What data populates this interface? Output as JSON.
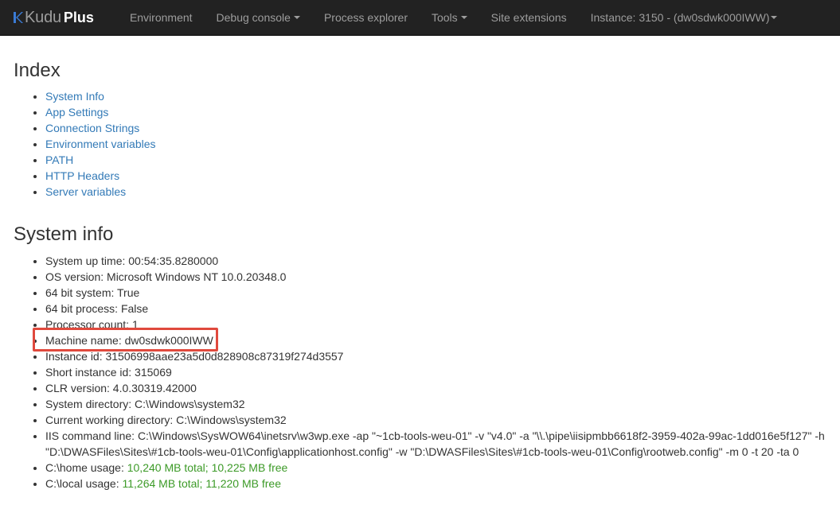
{
  "navbar": {
    "brand_kudu": "Kudu",
    "brand_plus": "Plus",
    "items": [
      {
        "label": "Environment",
        "dropdown": false
      },
      {
        "label": "Debug console",
        "dropdown": true
      },
      {
        "label": "Process explorer",
        "dropdown": false
      },
      {
        "label": "Tools",
        "dropdown": true
      },
      {
        "label": "Site extensions",
        "dropdown": false
      },
      {
        "label": "Instance: 3150 - (dw0sdwk000IWW)",
        "dropdown": true
      }
    ]
  },
  "index": {
    "title": "Index",
    "links": [
      "System Info",
      "App Settings",
      "Connection Strings",
      "Environment variables",
      "PATH",
      "HTTP Headers",
      "Server variables"
    ]
  },
  "system_info": {
    "title": "System info",
    "items": {
      "uptime": "System up time: 00:54:35.8280000",
      "os_version": "OS version: Microsoft Windows NT 10.0.20348.0",
      "bit64_system": "64 bit system: True",
      "bit64_process": "64 bit process: False",
      "processor_count": "Processor count: 1",
      "machine_name": "Machine name: dw0sdwk000IWW",
      "instance_id": "Instance id: 31506998aae23a5d0d828908c87319f274d3557",
      "short_instance_id": "Short instance id: 315069",
      "clr_version": "CLR version: 4.0.30319.42000",
      "system_directory": "System directory: C:\\Windows\\system32",
      "cwd": "Current working directory: C:\\Windows\\system32",
      "iis_line1": "IIS command line: C:\\Windows\\SysWOW64\\inetsrv\\w3wp.exe -ap \"~1cb-tools-weu-01\" -v \"v4.0\" -a \"\\\\.\\pipe\\iisipmbb6618f2-3959-402a-99ac-1dd016e5f127\" -h",
      "iis_line2": "\"D:\\DWASFiles\\Sites\\#1cb-tools-weu-01\\Config\\applicationhost.config\" -w \"D:\\DWASFiles\\Sites\\#1cb-tools-weu-01\\Config\\rootweb.config\" -m 0 -t 20 -ta 0",
      "home_label": "C:\\home usage: ",
      "home_total": "10,240 MB total; ",
      "home_free": "10,225 MB free",
      "local_label": "C:\\local usage: ",
      "local_total": "11,264 MB total; ",
      "local_free": "11,220 MB free"
    }
  },
  "colors": {
    "navbar_bg": "#222222",
    "link": "#337ab7",
    "usage_green": "#3c9a27",
    "highlight": "#e0493d"
  }
}
